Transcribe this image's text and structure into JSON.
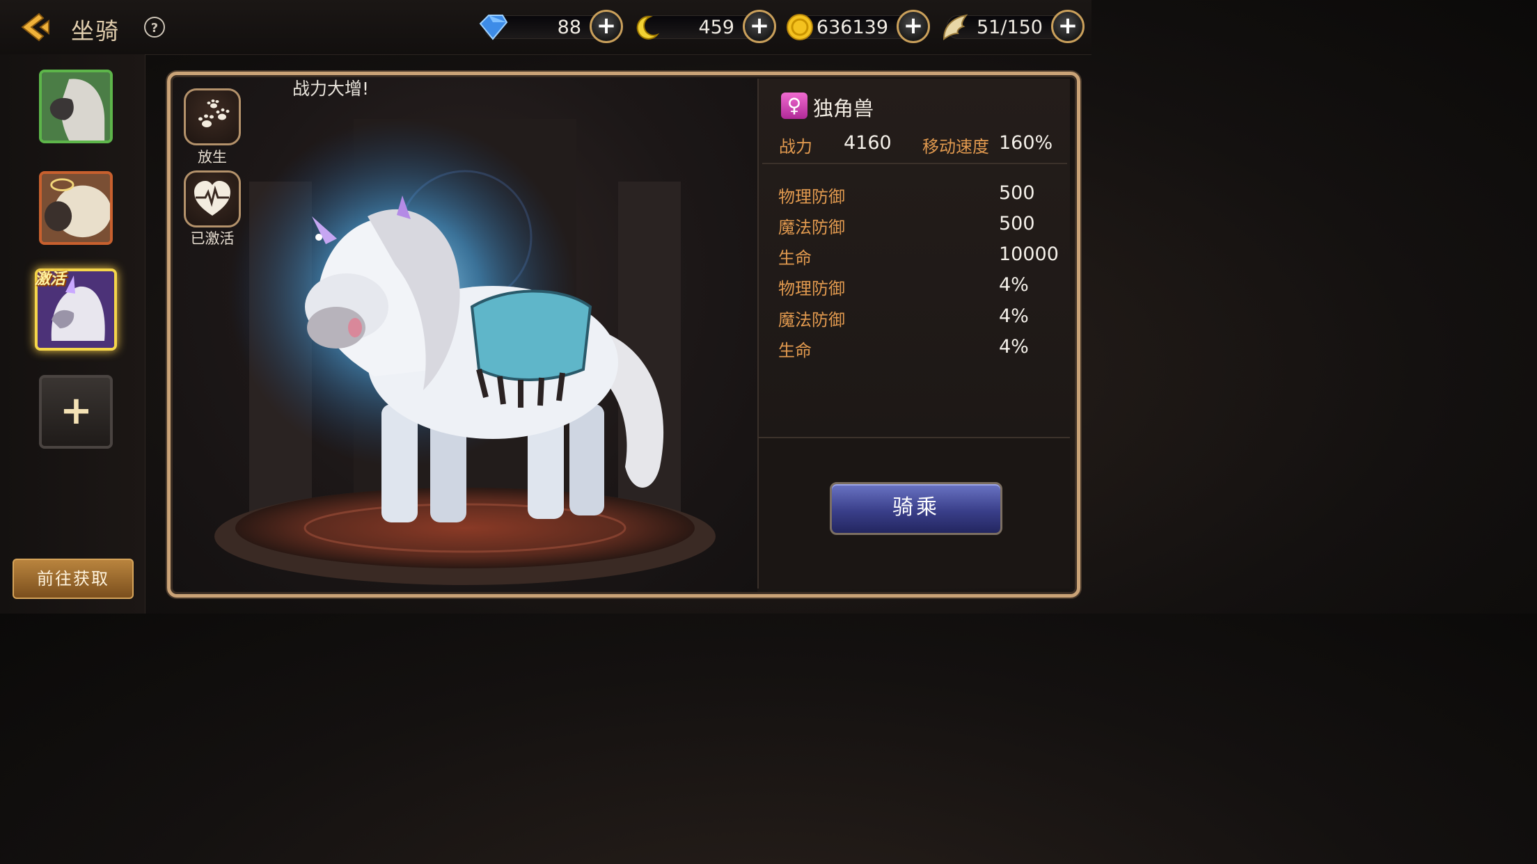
{
  "header": {
    "title": "坐骑",
    "help_label": "?"
  },
  "currencies": [
    {
      "name": "diamond",
      "icon": "blue-diamond-icon",
      "value": "88"
    },
    {
      "name": "crescent",
      "icon": "golden-crescent-icon",
      "value": "459"
    },
    {
      "name": "gold",
      "icon": "gold-coin-icon",
      "value": "636139"
    },
    {
      "name": "wing",
      "icon": "angel-wing-icon",
      "value": "51/150"
    }
  ],
  "mount_list": {
    "slots": [
      {
        "id": "grey-horse",
        "state": "normal"
      },
      {
        "id": "sheep",
        "state": "normal"
      },
      {
        "id": "unicorn",
        "state": "selected",
        "badge": "激活"
      }
    ],
    "add_slot_icon": "plus-icon",
    "goto_label": "前往获取"
  },
  "scene": {
    "banner_text": "战力大增!",
    "release_label": "放生",
    "activated_label": "已激活"
  },
  "mount": {
    "name": "独角兽",
    "gender_symbol": "♀",
    "power_label": "战力",
    "power_value": "4160",
    "speed_label": "移动速度",
    "speed_value": "160%",
    "stats": [
      {
        "label": "物理防御",
        "value": "500"
      },
      {
        "label": "魔法防御",
        "value": "500"
      },
      {
        "label": "生命",
        "value": "10000"
      },
      {
        "label": "物理防御",
        "value": "4%"
      },
      {
        "label": "魔法防御",
        "value": "4%"
      },
      {
        "label": "生命",
        "value": "4%"
      }
    ],
    "ride_label": "骑乘"
  },
  "colors": {
    "accent_gold": "#caa377",
    "stat_label": "#e29a4f",
    "ride_button": "#3a3f8a",
    "active_badge": "#f5d64a"
  }
}
